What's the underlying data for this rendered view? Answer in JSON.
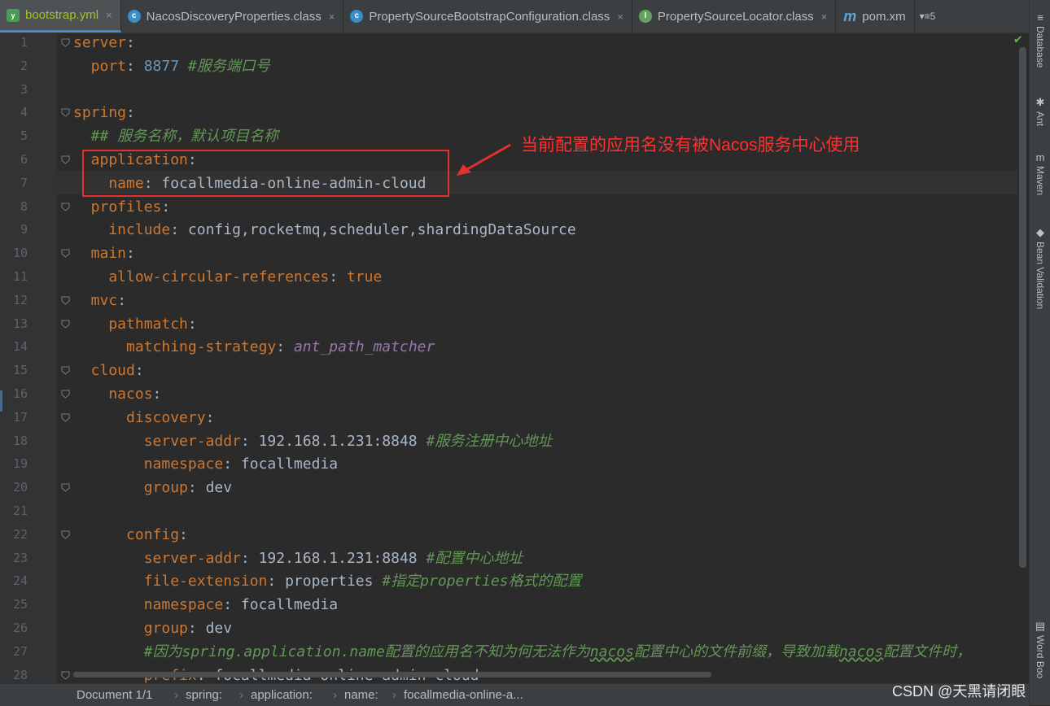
{
  "tabs": [
    {
      "label": "bootstrap.yml",
      "icon": "yaml-file-icon",
      "kind": "yml",
      "active": true
    },
    {
      "label": "NacosDiscoveryProperties.class",
      "icon": "class-file-icon",
      "kind": "cls",
      "active": false
    },
    {
      "label": "PropertySourceBootstrapConfiguration.class",
      "icon": "class-file-icon",
      "kind": "cls",
      "active": false
    },
    {
      "label": "PropertySourceLocator.class",
      "icon": "interface-file-icon",
      "kind": "ifc",
      "active": false
    },
    {
      "label": "pom.xm",
      "icon": "maven-file-icon",
      "kind": "mvn",
      "active": false
    }
  ],
  "tab_overflow": "▾≡5",
  "right_tools": [
    {
      "label": "Database",
      "icon": "database-icon"
    },
    {
      "label": "Ant",
      "icon": "ant-icon"
    },
    {
      "label": "Maven",
      "icon": "maven-icon"
    },
    {
      "label": "Bean Validation",
      "icon": "bean-validation-icon"
    },
    {
      "label": "Word Boo",
      "icon": "word-book-icon"
    }
  ],
  "lines": [
    [
      {
        "t": "server",
        "c": "k"
      },
      {
        "t": ":",
        "c": "p"
      }
    ],
    [
      {
        "t": "  port",
        "c": "k"
      },
      {
        "t": ": ",
        "c": "p"
      },
      {
        "t": "8877",
        "c": "n"
      },
      {
        "t": " #服务端口号",
        "c": "c"
      }
    ],
    [],
    [
      {
        "t": "spring",
        "c": "k"
      },
      {
        "t": ":",
        "c": "p"
      }
    ],
    [
      {
        "t": "  ## 服务名称，默认项目名称",
        "c": "c"
      }
    ],
    [
      {
        "t": "  application",
        "c": "k"
      },
      {
        "t": ":",
        "c": "p"
      }
    ],
    [
      {
        "t": "    name",
        "c": "k"
      },
      {
        "t": ": focallmedia-online-admin-cloud",
        "c": "p"
      }
    ],
    [
      {
        "t": "  profiles",
        "c": "k"
      },
      {
        "t": ":",
        "c": "p"
      }
    ],
    [
      {
        "t": "    include",
        "c": "k"
      },
      {
        "t": ": config,rocketmq,scheduler,shardingDataSource",
        "c": "p"
      }
    ],
    [
      {
        "t": "  main",
        "c": "k"
      },
      {
        "t": ":",
        "c": "p"
      }
    ],
    [
      {
        "t": "    allow-circular-references",
        "c": "k"
      },
      {
        "t": ": ",
        "c": "p"
      },
      {
        "t": "true",
        "c": "k"
      }
    ],
    [
      {
        "t": "  mvc",
        "c": "k"
      },
      {
        "t": ":",
        "c": "p"
      }
    ],
    [
      {
        "t": "    pathmatch",
        "c": "k"
      },
      {
        "t": ":",
        "c": "p"
      }
    ],
    [
      {
        "t": "      matching-strategy",
        "c": "k"
      },
      {
        "t": ": ",
        "c": "p"
      },
      {
        "t": "ant_path_matcher",
        "c": "e"
      }
    ],
    [
      {
        "t": "  cloud",
        "c": "k"
      },
      {
        "t": ":",
        "c": "p"
      }
    ],
    [
      {
        "t": "    nacos",
        "c": "k"
      },
      {
        "t": ":",
        "c": "p"
      }
    ],
    [
      {
        "t": "      discovery",
        "c": "k"
      },
      {
        "t": ":",
        "c": "p"
      }
    ],
    [
      {
        "t": "        server-addr",
        "c": "k"
      },
      {
        "t": ": 192.168.1.231:8848 ",
        "c": "p"
      },
      {
        "t": "#服务注册中心地址",
        "c": "c"
      }
    ],
    [
      {
        "t": "        namespace",
        "c": "k"
      },
      {
        "t": ": focallmedia",
        "c": "p"
      }
    ],
    [
      {
        "t": "        group",
        "c": "k"
      },
      {
        "t": ": dev",
        "c": "p"
      }
    ],
    [],
    [
      {
        "t": "      config",
        "c": "k"
      },
      {
        "t": ":",
        "c": "p"
      }
    ],
    [
      {
        "t": "        server-addr",
        "c": "k"
      },
      {
        "t": ": 192.168.1.231:8848 ",
        "c": "p"
      },
      {
        "t": "#配置中心地址",
        "c": "c"
      }
    ],
    [
      {
        "t": "        file-extension",
        "c": "k"
      },
      {
        "t": ": properties ",
        "c": "p"
      },
      {
        "t": "#指定properties格式的配置",
        "c": "c"
      }
    ],
    [
      {
        "t": "        namespace",
        "c": "k"
      },
      {
        "t": ": focallmedia",
        "c": "p"
      }
    ],
    [
      {
        "t": "        group",
        "c": "k"
      },
      {
        "t": ": dev",
        "c": "p"
      }
    ],
    [
      {
        "t": "        #因为spring.application.name配置的应用名不知为何无法作为",
        "c": "c"
      },
      {
        "t": "nacos",
        "c": "c u"
      },
      {
        "t": "配置中心的文件前缀，导致加载",
        "c": "c"
      },
      {
        "t": "nacos",
        "c": "c u"
      },
      {
        "t": "配置文件时，",
        "c": "c"
      }
    ],
    [
      {
        "t": "        prefix",
        "c": "k"
      },
      {
        "t": ": focallmedia-online-admin-cloud",
        "c": "p"
      }
    ]
  ],
  "annotation": "当前配置的应用名没有被Nacos服务中心使用",
  "breadcrumb": [
    "Document 1/1",
    "spring:",
    "application:",
    "name:",
    "focallmedia-online-a..."
  ],
  "watermark": "CSDN @天黑请闭眼",
  "colors": {
    "key": "#cc7832",
    "number": "#6897bb",
    "comment": "#629755",
    "enum": "#9876aa",
    "annotation": "#ff3030"
  }
}
